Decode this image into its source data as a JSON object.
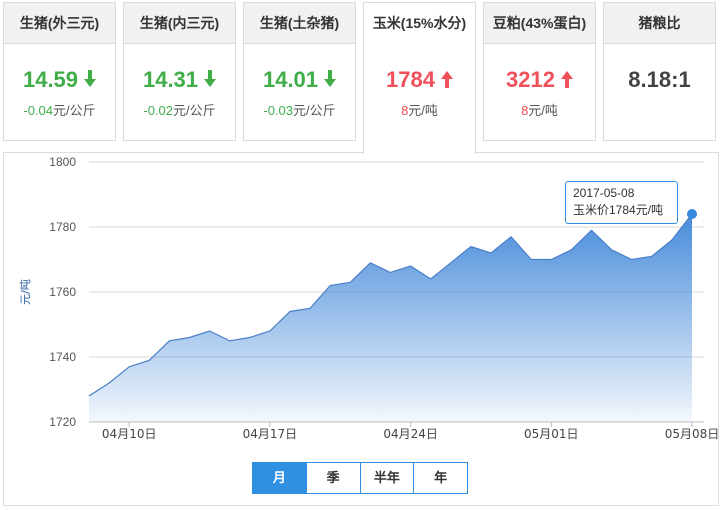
{
  "cards": [
    {
      "title": "生猪(外三元)",
      "price": "14.59",
      "direction": "down",
      "delta": "-0.04",
      "unit": "元/公斤"
    },
    {
      "title": "生猪(内三元)",
      "price": "14.31",
      "direction": "down",
      "delta": "-0.02",
      "unit": "元/公斤"
    },
    {
      "title": "生猪(土杂猪)",
      "price": "14.01",
      "direction": "down",
      "delta": "-0.03",
      "unit": "元/公斤"
    },
    {
      "title": "玉米(15%水分)",
      "price": "1784",
      "direction": "up",
      "delta": "8",
      "unit": "元/吨",
      "active": true
    },
    {
      "title": "豆粕(43%蛋白)",
      "price": "3212",
      "direction": "up",
      "delta": "8",
      "unit": "元/吨"
    },
    {
      "title": "猪粮比",
      "ratio": "8.18:1"
    }
  ],
  "colors": {
    "up": "#f0505a",
    "down": "#3fae49",
    "accent": "#2f8fe0",
    "series": "#4a90e2"
  },
  "tooltip": {
    "date": "2017-05-08",
    "text": "玉米价1784元/吨"
  },
  "range_tabs": {
    "items": [
      "月",
      "季",
      "半年",
      "年"
    ],
    "active": 0
  },
  "chart_data": {
    "type": "area",
    "ylabel": "元/吨",
    "ylim": [
      1720,
      1800
    ],
    "yticks": [
      1720,
      1740,
      1760,
      1780,
      1800
    ],
    "grid": true,
    "xticks": [
      "04月10日",
      "04月17日",
      "04月24日",
      "05月01日",
      "05月08日"
    ],
    "x": [
      "04-08",
      "04-09",
      "04-10",
      "04-11",
      "04-12",
      "04-13",
      "04-14",
      "04-15",
      "04-16",
      "04-17",
      "04-18",
      "04-19",
      "04-20",
      "04-21",
      "04-22",
      "04-23",
      "04-24",
      "04-25",
      "04-26",
      "04-27",
      "04-28",
      "04-29",
      "04-30",
      "05-01",
      "05-02",
      "05-03",
      "05-04",
      "05-05",
      "05-06",
      "05-07",
      "05-08"
    ],
    "series": [
      {
        "values": [
          1728,
          1732,
          1737,
          1739,
          1745,
          1746,
          1748,
          1745,
          1746,
          1748,
          1754,
          1755,
          1762,
          1763,
          1769,
          1766,
          1768,
          1764,
          1769,
          1774,
          1772,
          1777,
          1770,
          1770,
          1773,
          1779,
          1773,
          1770,
          1771,
          1776,
          1784
        ]
      }
    ]
  }
}
